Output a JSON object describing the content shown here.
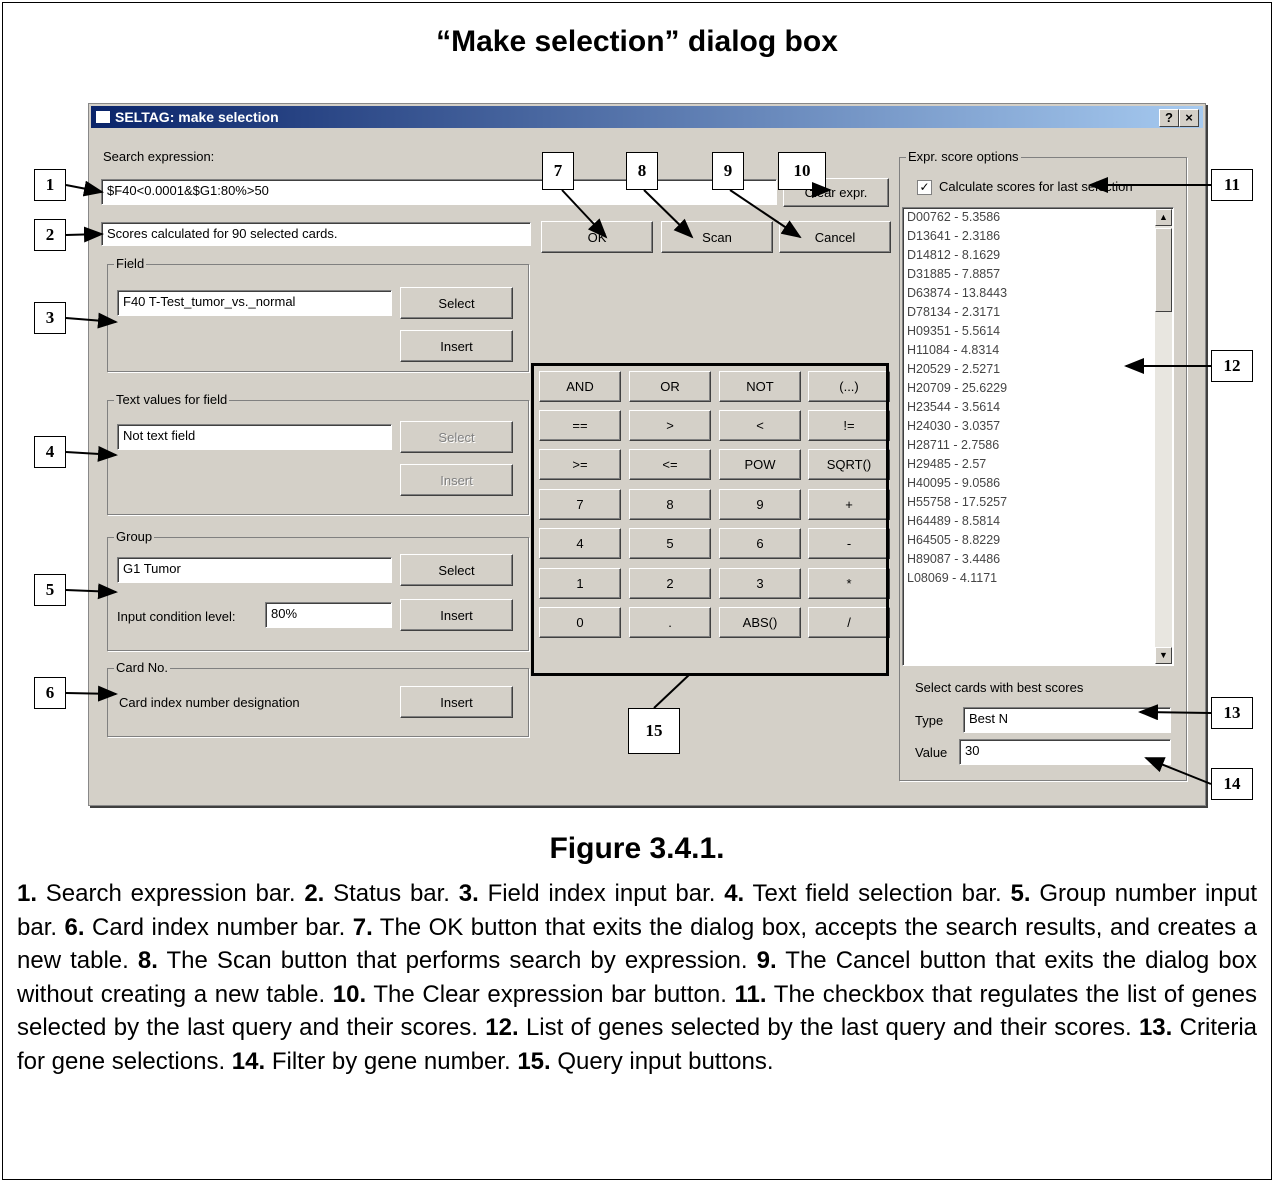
{
  "figure": {
    "title": "“Make selection” dialog box",
    "caption": "Figure 3.4.1."
  },
  "dialog": {
    "title": "SELTAG: make selection",
    "help_label": "?",
    "close_label": "×",
    "search_label": "Search expression:",
    "search_value": "$F40<0.0001&$G1:80%>50",
    "status_value": "Scores calculated for 90 selected cards.",
    "clear_label": "Clear expr.",
    "ok_label": "OK",
    "scan_label": "Scan",
    "cancel_label": "Cancel",
    "field_group": {
      "legend": "Field",
      "value": "F40 T-Test_tumor_vs._normal",
      "select_label": "Select",
      "insert_label": "Insert"
    },
    "text_group": {
      "legend": "Text values for field",
      "value": "Not text field",
      "select_label": "Select",
      "insert_label": "Insert"
    },
    "group_group": {
      "legend": "Group",
      "value": "G1 Tumor",
      "select_label": "Select",
      "level_label": "Input condition level:",
      "level_value": "80%",
      "insert_label": "Insert"
    },
    "card_group": {
      "legend": "Card No.",
      "text": "Card index number designation",
      "insert_label": "Insert"
    },
    "keypad": [
      "AND",
      "OR",
      "NOT",
      "(...)",
      "==",
      ">",
      "<",
      "!=",
      ">=",
      "<=",
      "POW",
      "SQRT()",
      "7",
      "8",
      "9",
      "+",
      "4",
      "5",
      "6",
      "-",
      "1",
      "2",
      "3",
      "*",
      "0",
      ".",
      "ABS()",
      "/"
    ],
    "score_group": {
      "legend": "Expr. score options",
      "checkbox_label": "Calculate scores for last selection",
      "checked": true,
      "items": [
        "D00762 - 5.3586",
        "D13641 - 2.3186",
        "D14812 - 8.1629",
        "D31885 - 7.8857",
        "D63874 - 13.8443",
        "D78134 - 2.3171",
        "H09351 - 5.5614",
        "H11084 - 4.8314",
        "H20529 - 2.5271",
        "H20709 - 25.6229",
        "H23544 - 3.5614",
        "H24030 - 3.0357",
        "H28711 - 2.7586",
        "H29485 - 2.57",
        "H40095 - 9.0586",
        "H55758 - 17.5257",
        "H64489 - 8.5814",
        "H64505 - 8.8229",
        "H89087 - 3.4486",
        "L08069 - 4.1171"
      ],
      "best_label": "Select cards with best scores",
      "type_label": "Type",
      "type_value": "Best N",
      "value_label": "Value",
      "value_value": "30"
    }
  },
  "callouts": [
    "1",
    "2",
    "3",
    "4",
    "5",
    "6",
    "7",
    "8",
    "9",
    "10",
    "11",
    "12",
    "13",
    "14",
    "15"
  ],
  "description": [
    {
      "num": "1.",
      "text": " Search expression bar. "
    },
    {
      "num": "2.",
      "text": " Status bar. "
    },
    {
      "num": "3.",
      "text": " Field index input bar. "
    },
    {
      "num": "4.",
      "text": " Text field selection bar. "
    },
    {
      "num": "5.",
      "text": " Group number input bar. "
    },
    {
      "num": "6.",
      "text": " Card index number bar. "
    },
    {
      "num": "7.",
      "text": " The OK button that exits the dialog box, accepts the search results, and creates a new table. "
    },
    {
      "num": "8.",
      "text": " The Scan button that performs search by expression. "
    },
    {
      "num": "9.",
      "text": " The Cancel button that exits the dialog box without creating a new table. "
    },
    {
      "num": "10.",
      "text": " The Clear expression bar button. "
    },
    {
      "num": "11.",
      "text": " The checkbox that regulates the list of genes selected by the last query and their scores. "
    },
    {
      "num": "12.",
      "text": " List of genes selected by the last query and their scores. "
    },
    {
      "num": "13.",
      "text": " Criteria for gene selections. "
    },
    {
      "num": "14.",
      "text": " Filter by gene number. "
    },
    {
      "num": "15.",
      "text": " Query input buttons."
    }
  ]
}
